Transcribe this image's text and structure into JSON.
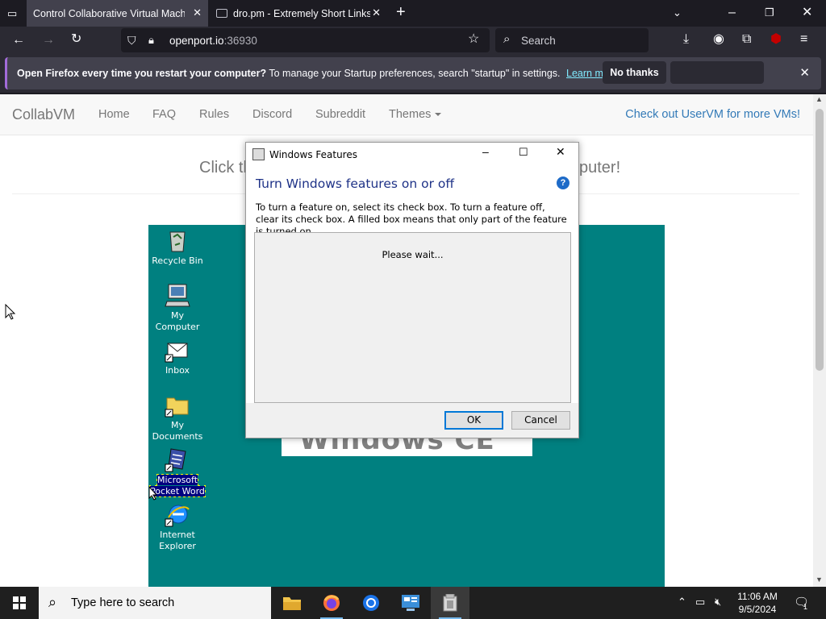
{
  "browser": {
    "tabs": [
      {
        "title": "Control Collaborative Virtual Machine",
        "active": true
      },
      {
        "title": "dro.pm - Extremely Short Links",
        "active": false
      }
    ],
    "url": {
      "host": "openport.io",
      "port": ":36930"
    },
    "search_placeholder": "Search",
    "notification": {
      "bold_text": "Open Firefox every time you restart your computer?",
      "text": "To manage your Startup preferences, search \"startup\" in settings.",
      "link": "Learn more",
      "button": "No thanks"
    }
  },
  "site": {
    "brand": "CollabVM",
    "nav": [
      "Home",
      "FAQ",
      "Rules",
      "Discord",
      "Subreddit",
      "Themes"
    ],
    "promo": "Check out UserVM for more VMs!",
    "header_left": "Click th",
    "header_right": "puter!"
  },
  "vm": {
    "desktop_icons": [
      {
        "label": "Recycle Bin",
        "selected": false
      },
      {
        "label": "My Computer",
        "selected": false
      },
      {
        "label": "Inbox",
        "selected": false
      },
      {
        "label": "My Documents",
        "selected": false
      },
      {
        "label": "Microsoft Pocket Word",
        "selected": true
      },
      {
        "label": "Internet Explorer",
        "selected": false
      }
    ],
    "banner": "Windows CE"
  },
  "dialog": {
    "title": "Windows Features",
    "heading": "Turn Windows features on or off",
    "description": "To turn a feature on, select its check box. To turn a feature off, clear its check box. A filled box means that only part of the feature is turned on.",
    "status": "Please wait...",
    "ok": "OK",
    "cancel": "Cancel"
  },
  "taskbar": {
    "search_placeholder": "Type here to search",
    "time": "11:06 AM",
    "date": "9/5/2024",
    "notification_count": "1"
  },
  "colors": {
    "vm_desktop": "#008080",
    "dialog_heading": "#1e3287",
    "link": "#337ab7"
  }
}
